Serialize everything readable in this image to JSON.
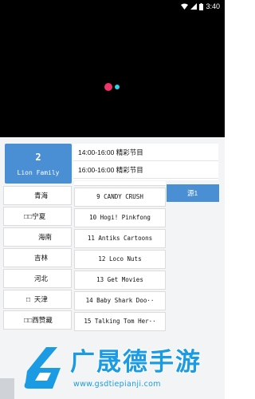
{
  "status_bar": {
    "time": "3:40",
    "icons": [
      "wifi-icon",
      "signal-icon",
      "battery-icon"
    ]
  },
  "current_channel": {
    "number": "2",
    "name": "Lion Family"
  },
  "epg": [
    {
      "label": "14:00-16:00 精彩节目"
    },
    {
      "label": "16:00-16:00 精彩节目"
    }
  ],
  "regions": [
    {
      "label": "青海"
    },
    {
      "label": "□□宁夏"
    },
    {
      "label": "海南"
    },
    {
      "label": "吉林"
    },
    {
      "label": "河北"
    },
    {
      "label": "□  天津"
    },
    {
      "label": "□□西赞藏"
    }
  ],
  "channels": [
    {
      "label": "9 CANDY CRUSH"
    },
    {
      "label": "10 Hogi! Pinkfong"
    },
    {
      "label": "11 Antiks Cartoons"
    },
    {
      "label": "12 Loco Nuts"
    },
    {
      "label": "13 Get Movies"
    },
    {
      "label": "14 Baby Shark Doo··"
    },
    {
      "label": "15 Talking Tom Her··"
    }
  ],
  "source_button": {
    "label": "源1"
  },
  "watermark": {
    "title": "广晟德手游",
    "url": "www.gsdtiepianji.com"
  },
  "colors": {
    "accent": "#4a8fd4",
    "watermark": "#1a9be3",
    "dot_pink": "#f0336b",
    "dot_cyan": "#2fd3e8"
  }
}
